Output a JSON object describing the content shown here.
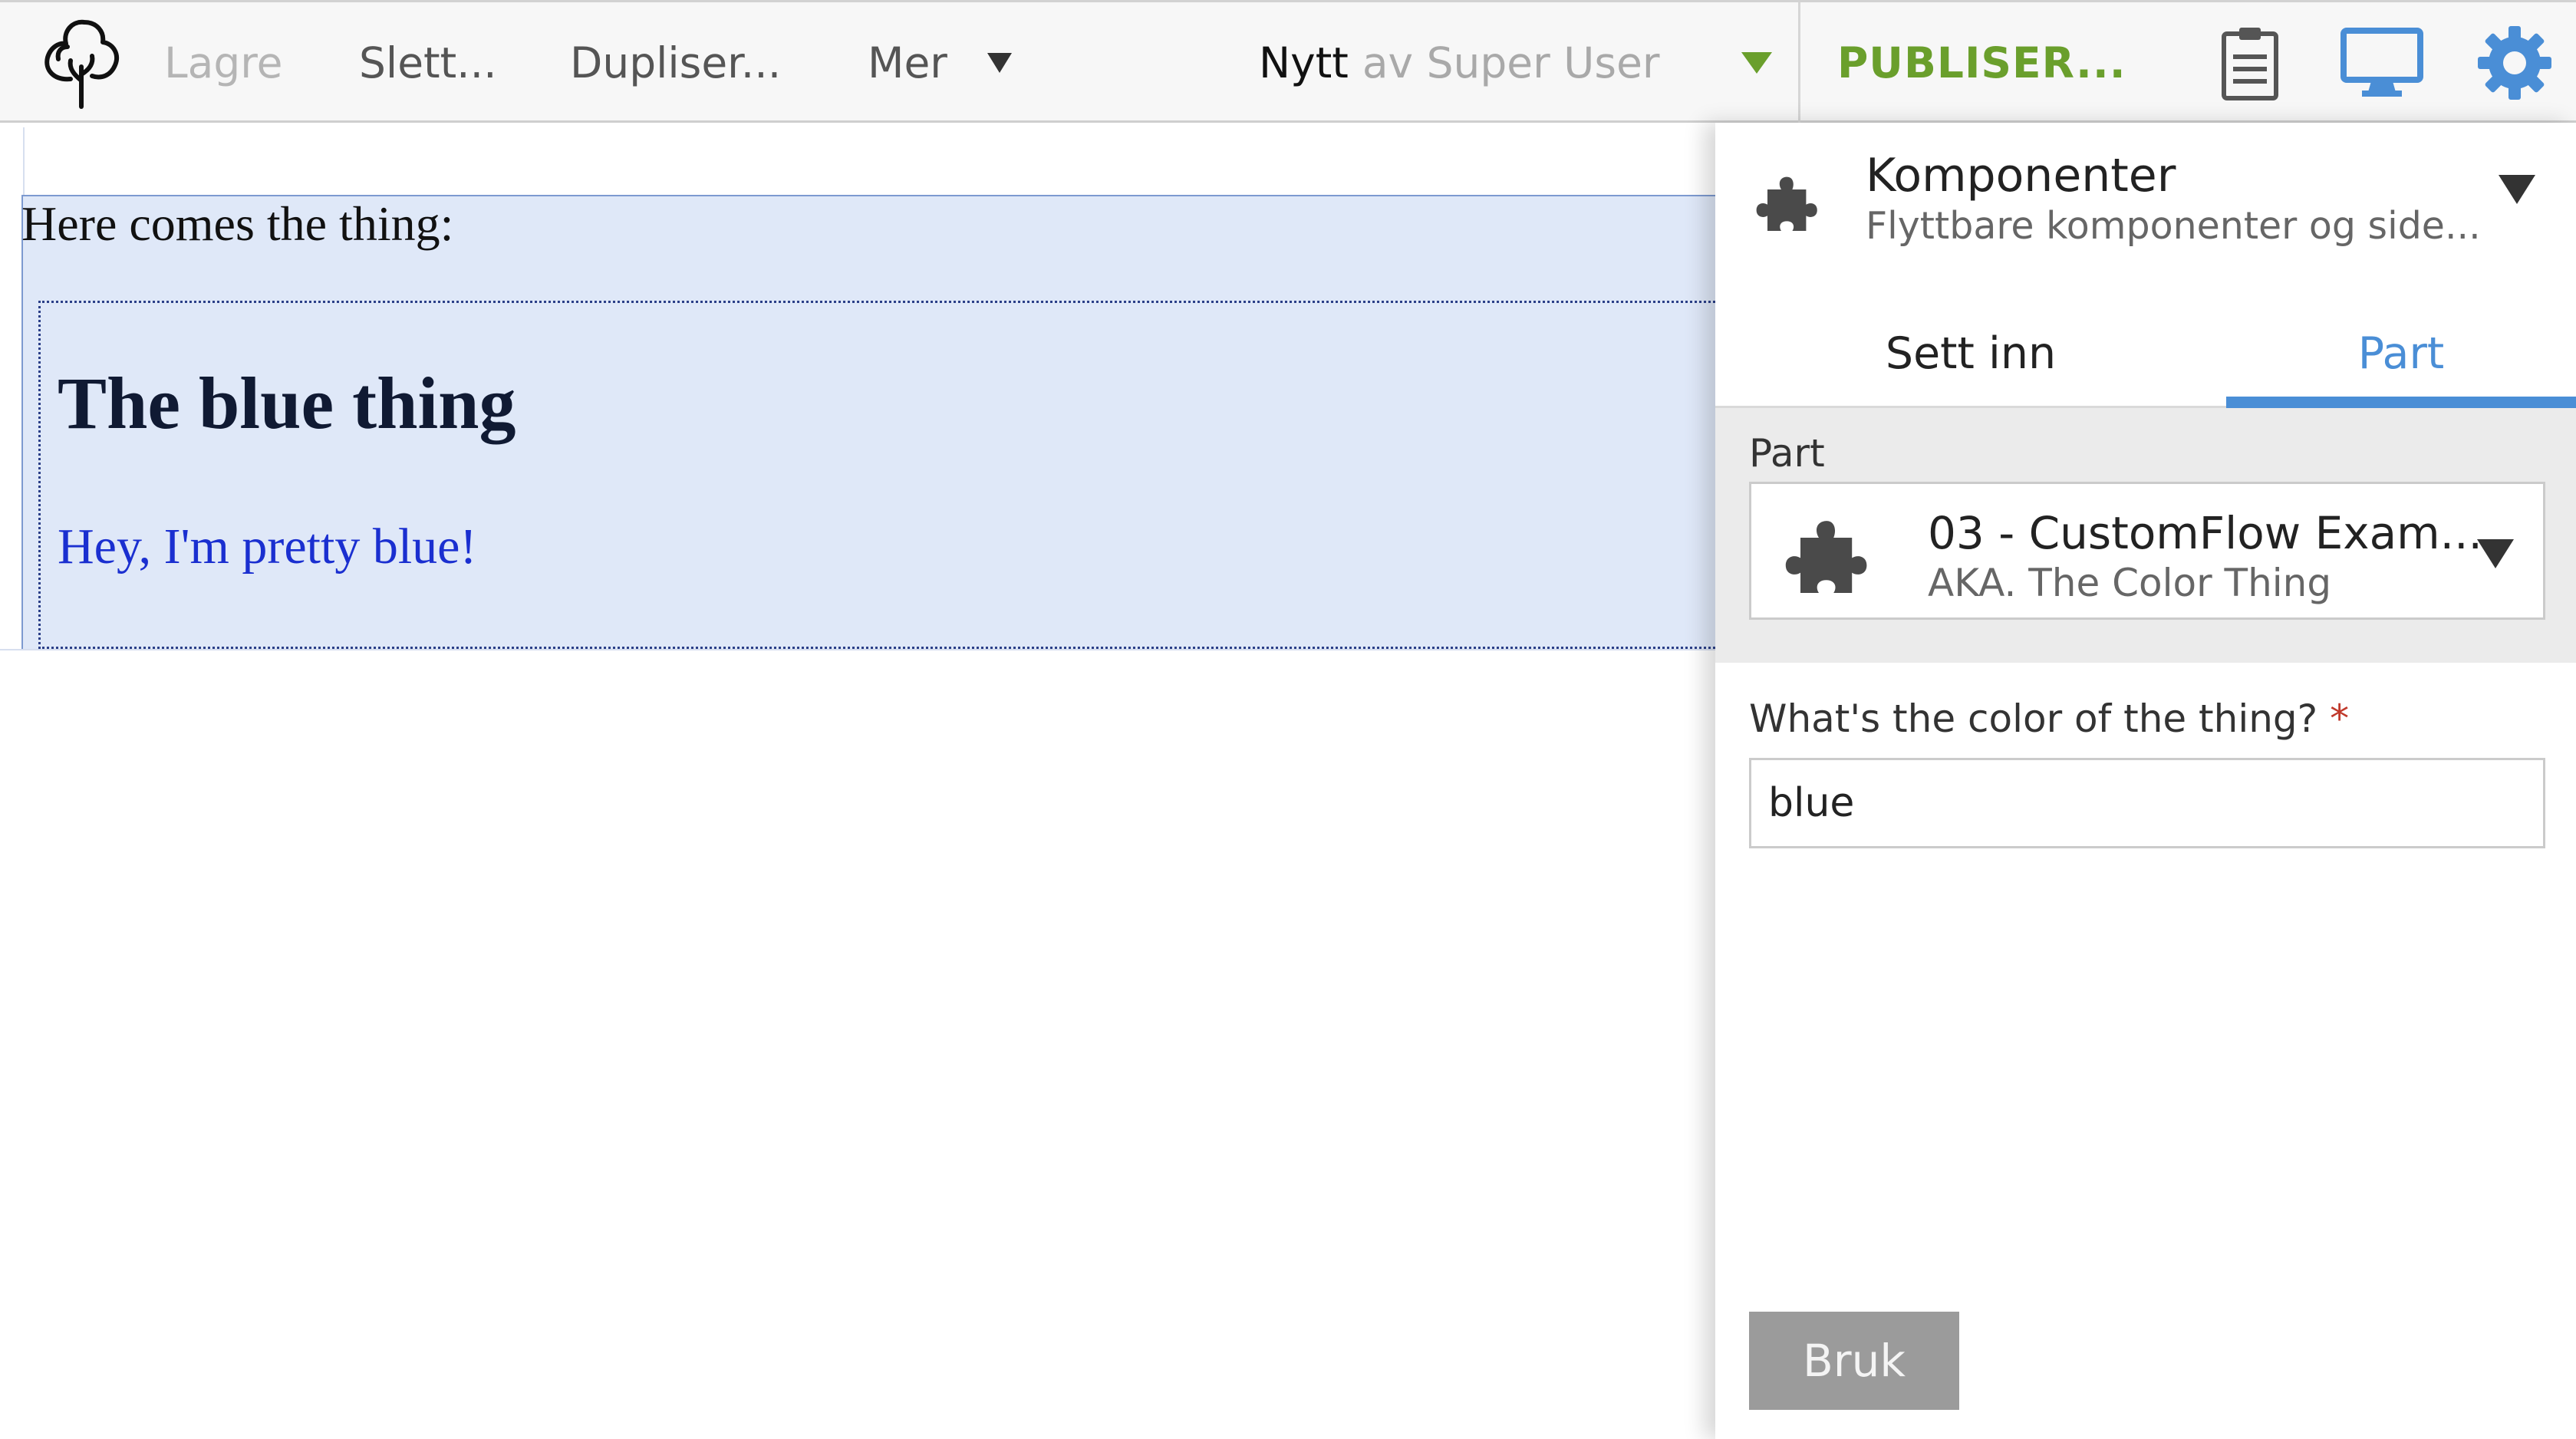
{
  "toolbar": {
    "save_label": "Lagre",
    "delete_label": "Slett...",
    "duplicate_label": "Dupliser...",
    "more_label": "Mer",
    "status_state": "Nytt",
    "status_by": "av Super User",
    "publish_label": "PUBLISER...",
    "icons": [
      "tree-logo-icon",
      "clipboard-icon",
      "monitor-icon",
      "gear-icon"
    ],
    "colors": {
      "publish": "#6a9f2c",
      "accent": "#4a8ed6"
    }
  },
  "content": {
    "intro_text": "Here comes the thing:",
    "part_heading": "The blue thing",
    "part_text": "Hey, I'm pretty blue!"
  },
  "panel": {
    "title": "Komponenter",
    "subtitle": "Flyttbare komponenter og side...",
    "tabs": [
      {
        "label": "Sett inn",
        "active": false
      },
      {
        "label": "Part",
        "active": true
      }
    ],
    "part_label": "Part",
    "selected_part": {
      "title": "03 - CustomFlow Exam...",
      "subtitle": "AKA. The Color Thing"
    },
    "color_field": {
      "label": "What's the color of the thing?",
      "required_marker": "*",
      "value": "blue"
    },
    "apply_label": "Bruk"
  }
}
